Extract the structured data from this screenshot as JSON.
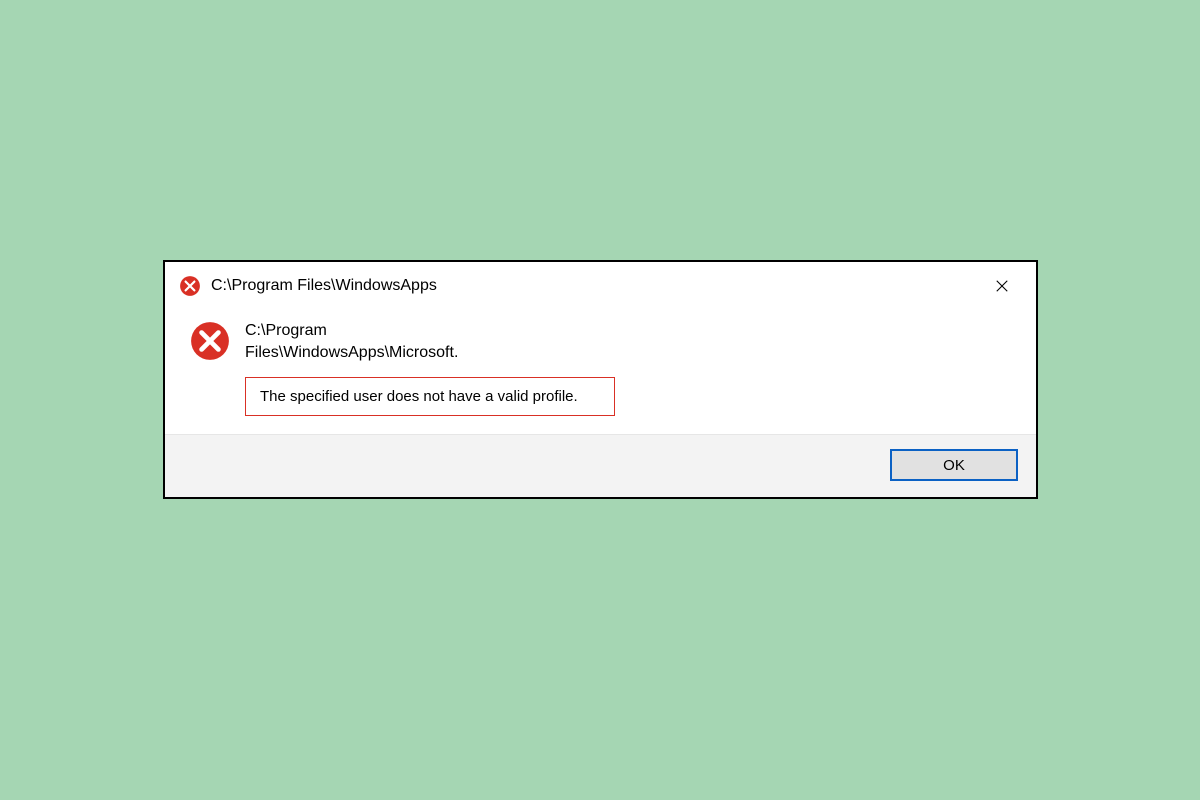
{
  "dialog": {
    "title": "C:\\Program Files\\WindowsApps",
    "path_line1": "C:\\Program",
    "path_line2": "Files\\WindowsApps\\Microsoft.",
    "error_message": "The specified user does not have a valid profile.",
    "ok_label": "OK",
    "icon_color": "#d93025",
    "accent_color": "#0b61c4"
  }
}
